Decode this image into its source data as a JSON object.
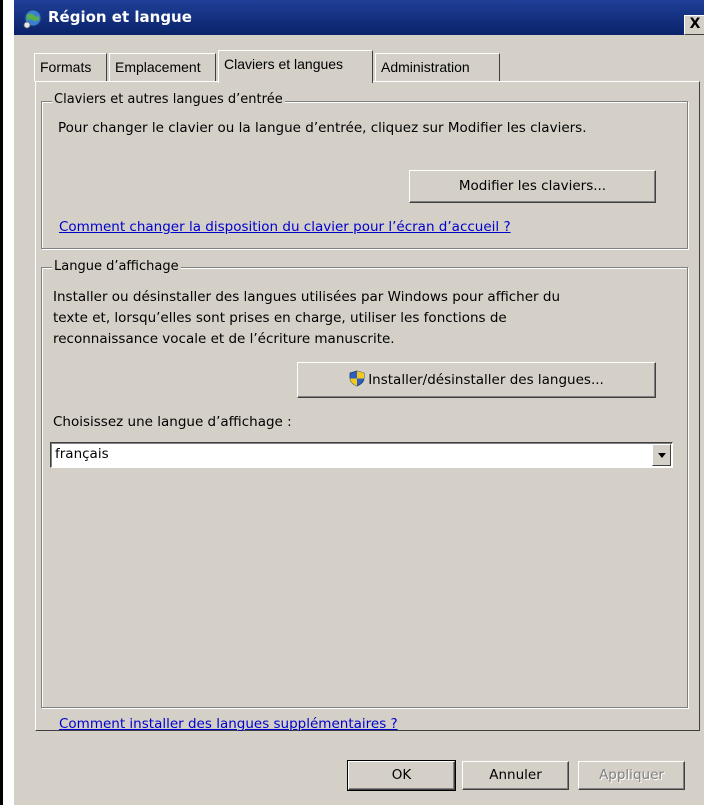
{
  "window": {
    "title": "Région et langue",
    "close_label": "X"
  },
  "tabs": [
    {
      "label": "Formats"
    },
    {
      "label": "Emplacement"
    },
    {
      "label": "Claviers et langues",
      "active": true
    },
    {
      "label": "Administration"
    }
  ],
  "keyboards_group": {
    "legend": "Claviers et autres langues d’entrée",
    "description": "Pour changer le clavier ou la langue d’entrée, cliquez sur Modifier les claviers.",
    "modify_button": "Modifier les claviers...",
    "help_link": "Comment changer la disposition du clavier pour l’écran d’accueil ?"
  },
  "display_group": {
    "legend": "Langue d’affichage",
    "description_line1": "Installer ou désinstaller des langues utilisées par Windows pour afficher du",
    "description_line2": "texte et, lorsqu’elles sont prises en charge, utiliser les fonctions de",
    "description_line3": "reconnaissance vocale et de l’écriture manuscrite.",
    "install_button": "Installer/désinstaller des langues...",
    "choose_label": "Choisissez une langue d’affichage :",
    "selected_language": "français"
  },
  "footer": {
    "help_link": "Comment installer des langues supplémentaires ?",
    "ok": "OK",
    "cancel": "Annuler",
    "apply": "Appliquer"
  }
}
